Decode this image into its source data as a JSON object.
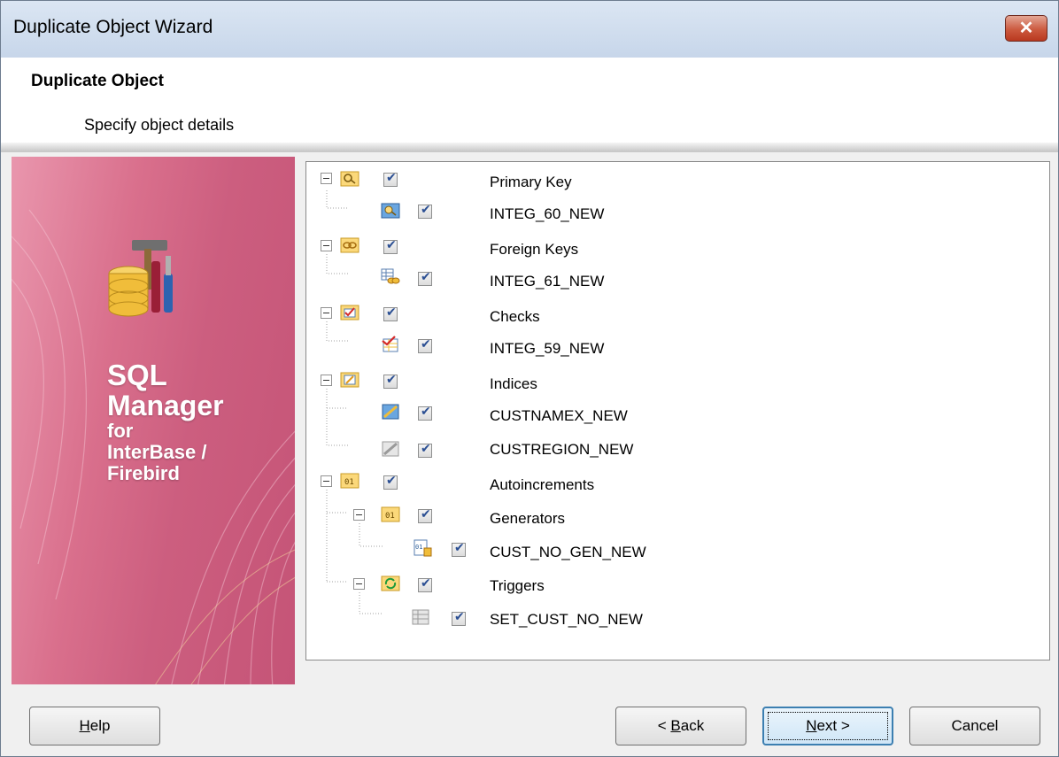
{
  "window": {
    "title": "Duplicate Object Wizard",
    "close_icon": "close-icon"
  },
  "header": {
    "title": "Duplicate Object",
    "subtitle": "Specify object details"
  },
  "sidebar": {
    "product_line1": "SQL",
    "product_line2": "Manager",
    "product_line3": "for",
    "product_line4": "InterBase /",
    "product_line5": "Firebird"
  },
  "tree": {
    "nodes": [
      {
        "label": "Primary Key",
        "icon": "primary-key-folder-icon",
        "checked": true,
        "expanded": true
      },
      {
        "label": "INTEG_60_NEW",
        "icon": "primary-key-icon",
        "checked": true
      },
      {
        "label": "Foreign Keys",
        "icon": "foreign-key-folder-icon",
        "checked": true,
        "expanded": true
      },
      {
        "label": "INTEG_61_NEW",
        "icon": "foreign-key-icon",
        "checked": true
      },
      {
        "label": "Checks",
        "icon": "checks-folder-icon",
        "checked": true,
        "expanded": true
      },
      {
        "label": "INTEG_59_NEW",
        "icon": "check-icon",
        "checked": true
      },
      {
        "label": "Indices",
        "icon": "indices-folder-icon",
        "checked": true,
        "expanded": true
      },
      {
        "label": "CUSTNAMEX_NEW",
        "icon": "index-icon",
        "checked": true
      },
      {
        "label": "CUSTREGION_NEW",
        "icon": "index-disabled-icon",
        "checked": true
      },
      {
        "label": "Autoincrements",
        "icon": "autoincrements-folder-icon",
        "checked": true,
        "expanded": true
      },
      {
        "label": "Generators",
        "icon": "generators-folder-icon",
        "checked": true,
        "expanded": true
      },
      {
        "label": "CUST_NO_GEN_NEW",
        "icon": "generator-icon",
        "checked": true
      },
      {
        "label": "Triggers",
        "icon": "triggers-folder-icon",
        "checked": true,
        "expanded": true
      },
      {
        "label": "SET_CUST_NO_NEW",
        "icon": "trigger-icon",
        "checked": true
      }
    ]
  },
  "buttons": {
    "help": {
      "prefix": "",
      "mnemonic": "H",
      "suffix": "elp"
    },
    "back": {
      "prefix": "< ",
      "mnemonic": "B",
      "suffix": "ack"
    },
    "next": {
      "prefix": "",
      "mnemonic": "N",
      "suffix": "ext >"
    },
    "cancel": {
      "label": "Cancel"
    }
  },
  "colors": {
    "sidebar_pink": "#d96f8c",
    "titlebar": "#c7d6ea",
    "checkmark": "#2b4f93",
    "default_button_border": "#3c7fb1"
  }
}
